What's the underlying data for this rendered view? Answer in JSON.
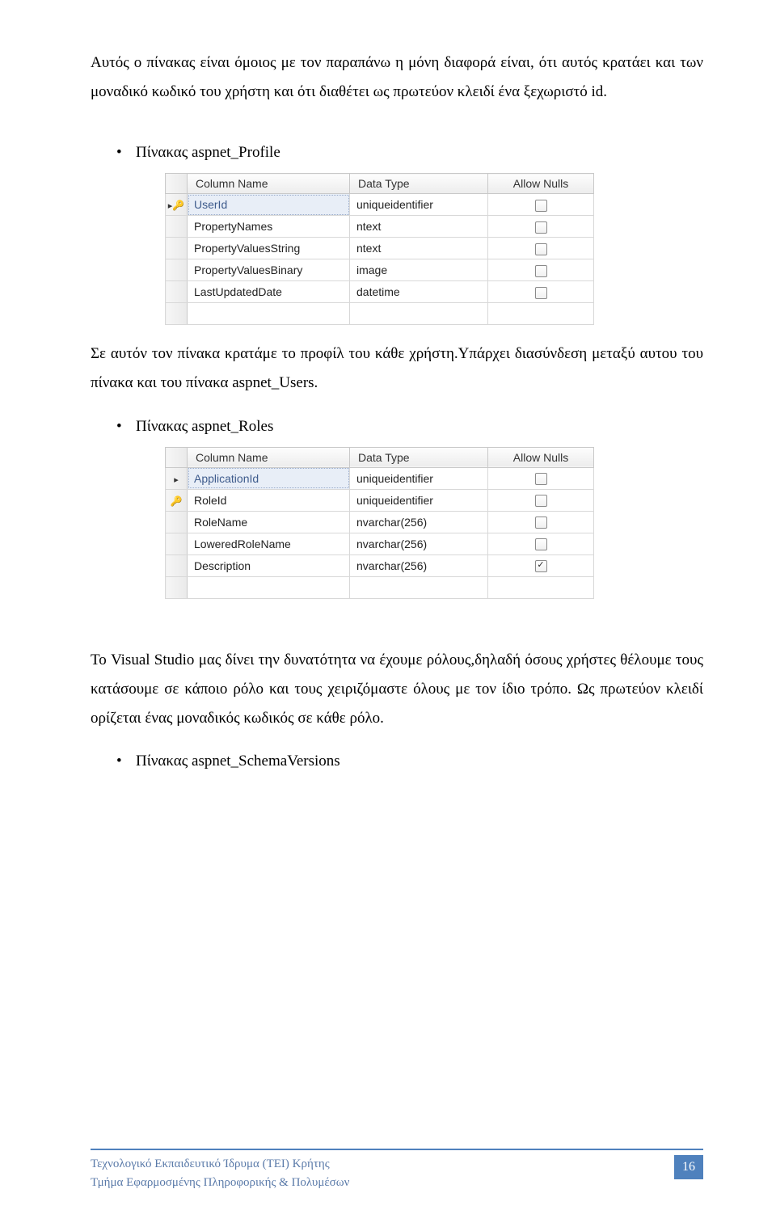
{
  "paragraphs": {
    "p1": "Αυτός ο πίνακας είναι όμοιος με τον παραπάνω η μόνη διαφορά είναι, ότι αυτός κρατάει και των μοναδικό κωδικό του χρήστη και ότι διαθέτει ως πρωτεύον κλειδί ένα ξεχωριστό id.",
    "p2": "Σε αυτόν τον πίνακα κρατάμε το προφίλ του κάθε χρήστη.Υπάρχει διασύνδεση μεταξύ αυτου του πίνακα και του πίνακα aspnet_Users.",
    "p3": "Το Visual Studio μας δίνει την δυνατότητα να έχουμε ρόλους,δηλαδή όσους χρήστες θέλουμε τους κατάσουμε σε κάποιο ρόλο και τους χειριζόμαστε όλους με τον ίδιο τρόπο. Ως πρωτεύον κλειδί ορίζεται ένας μοναδικός κωδικός σε κάθε ρόλο."
  },
  "bullets": {
    "b1": "Πίνακας  aspnet_Profile",
    "b2": "Πίνακας  aspnet_Roles",
    "b3": "Πίνακας  aspnet_SchemaVersions"
  },
  "tableHeaders": {
    "colName": "Column Name",
    "dataType": "Data Type",
    "allowNulls": "Allow Nulls"
  },
  "table1": {
    "rows": [
      {
        "gutter_arrow": true,
        "gutter_key": true,
        "name": "UserId",
        "type": "uniqueidentifier",
        "selected": true,
        "checked": false
      },
      {
        "gutter_arrow": false,
        "gutter_key": false,
        "name": "PropertyNames",
        "type": "ntext",
        "selected": false,
        "checked": false
      },
      {
        "gutter_arrow": false,
        "gutter_key": false,
        "name": "PropertyValuesString",
        "type": "ntext",
        "selected": false,
        "checked": false
      },
      {
        "gutter_arrow": false,
        "gutter_key": false,
        "name": "PropertyValuesBinary",
        "type": "image",
        "selected": false,
        "checked": false
      },
      {
        "gutter_arrow": false,
        "gutter_key": false,
        "name": "LastUpdatedDate",
        "type": "datetime",
        "selected": false,
        "checked": false
      },
      {
        "gutter_arrow": false,
        "gutter_key": false,
        "name": "",
        "type": "",
        "selected": false,
        "checked": false,
        "empty": true
      }
    ]
  },
  "table2": {
    "rows": [
      {
        "gutter_arrow": true,
        "gutter_key": false,
        "name": "ApplicationId",
        "type": "uniqueidentifier",
        "selected": true,
        "checked": false
      },
      {
        "gutter_arrow": false,
        "gutter_key": true,
        "name": "RoleId",
        "type": "uniqueidentifier",
        "selected": false,
        "checked": false
      },
      {
        "gutter_arrow": false,
        "gutter_key": false,
        "name": "RoleName",
        "type": "nvarchar(256)",
        "selected": false,
        "checked": false
      },
      {
        "gutter_arrow": false,
        "gutter_key": false,
        "name": "LoweredRoleName",
        "type": "nvarchar(256)",
        "selected": false,
        "checked": false
      },
      {
        "gutter_arrow": false,
        "gutter_key": false,
        "name": "Description",
        "type": "nvarchar(256)",
        "selected": false,
        "checked": true
      },
      {
        "gutter_arrow": false,
        "gutter_key": false,
        "name": "",
        "type": "",
        "selected": false,
        "checked": false,
        "empty": true
      }
    ]
  },
  "footer": {
    "line1": "Τεχνολογικό Εκπαιδευτικό Ίδρυμα (ΤΕΙ) Κρήτης",
    "line2": "Τμήμα Εφαρμοσμένης Πληροφορικής & Πολυμέσων",
    "page": "16"
  },
  "glyphs": {
    "bullet": "•",
    "check": "✓",
    "key": "🔑",
    "arrow": "▸"
  }
}
